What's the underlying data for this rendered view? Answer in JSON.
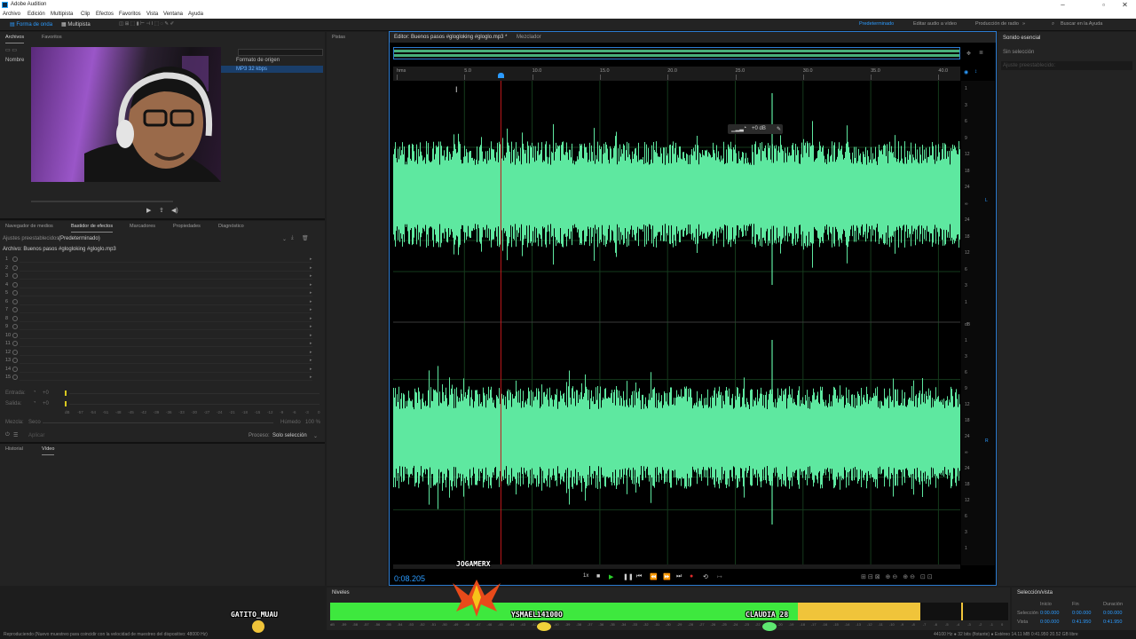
{
  "window": {
    "title": "Adobe Audition"
  },
  "menu": [
    "Archivo",
    "Edición",
    "Multipista",
    "Clip",
    "Efectos",
    "Favoritos",
    "Vista",
    "Ventana",
    "Ayuda"
  ],
  "toolbar": {
    "tab_waveform": "Forma de onda",
    "tab_multitrack": "Multipista",
    "workspaces": [
      "Predeterminado",
      "Editar audio a vídeo",
      "Producción de radio"
    ],
    "search_placeholder": "Buscar en la Ayuda"
  },
  "files_panel": {
    "tabs": [
      "Archivos",
      "Favoritos"
    ],
    "col_name": "Nombre",
    "col_format": "Formato de origen",
    "row_format": "MP3 32 kbps"
  },
  "effects_panel": {
    "tabs": [
      "Navegador de medios",
      "Bastidor de efectos",
      "Marcadores",
      "Propiedades",
      "Diagnóstico"
    ],
    "preset_label": "Ajustes preestablecidos:",
    "preset_value": "(Predeterminado)",
    "file_line": "Archivo: Buenos pasos #glogloking #gloglo.mp3",
    "slots": [
      "1",
      "2",
      "3",
      "4",
      "5",
      "6",
      "7",
      "8",
      "9",
      "10",
      "11",
      "12",
      "13",
      "14",
      "15"
    ],
    "input_label": "Entrada:",
    "output_label": "Salida:",
    "gain_value": "+0",
    "mix_label": "Mezcla:",
    "mix_dry": "Seco",
    "mix_wet": "Húmedo",
    "mix_pct": "100 %",
    "meter_ticks": [
      "dB",
      "-57",
      "-54",
      "-51",
      "-48",
      "-45",
      "-42",
      "-39",
      "-36",
      "-33",
      "-30",
      "-27",
      "-24",
      "-21",
      "-18",
      "-15",
      "-12",
      "-9",
      "-6",
      "-3",
      "0"
    ],
    "apply_label": "Aplicar",
    "process_label": "Proceso:",
    "process_value": "Solo selección"
  },
  "history_panel": {
    "tabs": [
      "Historial",
      "Vídeo"
    ]
  },
  "tracks_panel": {
    "title": "Pistas"
  },
  "editor": {
    "tab_editor": "Editor: Buenos pasos #glogloking #gloglo.mp3 *",
    "tab_mixer": "Mezclador",
    "ruler": [
      "hms",
      "5.0",
      "10.0",
      "15.0",
      "20.0",
      "25.0",
      "30.0",
      "35.0",
      "40.0"
    ],
    "hud_value": "+0 dB",
    "db_scale_top": [
      "1",
      "3",
      "6",
      "9",
      "12",
      "18",
      "24",
      "∞",
      "24",
      "18",
      "12",
      "6",
      "3",
      "1"
    ],
    "db_scale_bottom": [
      "dB",
      "1",
      "3",
      "6",
      "9",
      "12",
      "18",
      "24",
      "∞",
      "24",
      "18",
      "12",
      "6",
      "3",
      "1"
    ],
    "channel_top": "L",
    "channel_bottom": "R",
    "playhead_fraction": 0.19,
    "current_time": "0:08.205",
    "speed": "1x"
  },
  "essential_sound": {
    "title": "Sonido esencial",
    "no_selection": "Sin selección",
    "preset_placeholder": "Ajuste preestablecido:"
  },
  "levels": {
    "title": "Niveles",
    "ticks": [
      "dB",
      "-59",
      "-58",
      "-57",
      "-56",
      "-55",
      "-54",
      "-53",
      "-52",
      "-51",
      "-50",
      "-49",
      "-48",
      "-47",
      "-46",
      "-45",
      "-44",
      "-43",
      "-42",
      "-41",
      "-40",
      "-39",
      "-38",
      "-37",
      "-36",
      "-35",
      "-34",
      "-33",
      "-32",
      "-31",
      "-30",
      "-29",
      "-28",
      "-27",
      "-26",
      "-25",
      "-24",
      "-23",
      "-22",
      "-21",
      "-20",
      "-19",
      "-18",
      "-17",
      "-16",
      "-15",
      "-14",
      "-13",
      "-12",
      "-11",
      "-10",
      "-9",
      "-8",
      "-7",
      "-6",
      "-5",
      "-4",
      "-3",
      "-2",
      "-1",
      "0"
    ],
    "green_fraction": 0.69,
    "yellow_fraction": 0.87,
    "peak_fraction": 0.93
  },
  "selection_view": {
    "title": "Selección/vista",
    "col_start": "Inicio",
    "col_end": "Fin",
    "col_duration": "Duración",
    "row_selection": "Selección",
    "row_view": "Vista",
    "sel_start": "0:00.000",
    "sel_end": "0:00.000",
    "sel_duration": "0:00.000",
    "view_start": "0:00.000",
    "view_end": "0:41.950",
    "view_duration": "0:41.950"
  },
  "status": {
    "left": "Reproduciendo (Nuevo muestreo para coincidir con la velocidad de muestreo del dispositivo: 48000 Hz)",
    "right": "44100 Hz ● 32 bits (flotante) ● Estéreo     14.11 MB     0:41.950     20.52 GB libre"
  },
  "overlays": [
    "JOGAMERX",
    "YSMAEL14100O",
    "CLAUDIA 28",
    "GATITO_MUAU"
  ],
  "colors": {
    "accent": "#2b9bff",
    "waveform": "#5ee8a0",
    "playhead": "#c2181c",
    "meter_green": "#3ee83e",
    "meter_yellow": "#f0c43a"
  }
}
